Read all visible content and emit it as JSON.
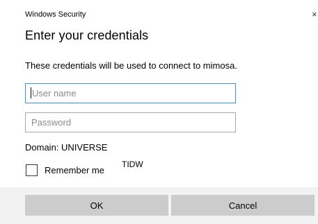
{
  "window": {
    "title": "Windows Security",
    "close_glyph": "×"
  },
  "dialog": {
    "heading": "Enter your credentials",
    "message": "These credentials will be used to connect to mimosa.",
    "username": {
      "value": "",
      "placeholder": "User name"
    },
    "password": {
      "value": "",
      "placeholder": "Password"
    },
    "domain": "Domain: UNIVERSE",
    "remember_me": {
      "label": "Remember me",
      "checked": false
    },
    "overlay_text": "TIDW"
  },
  "buttons": {
    "ok": "OK",
    "cancel": "Cancel"
  },
  "colors": {
    "focus_border": "#3a8fd6",
    "field_border": "#a8a8a8",
    "button_bg": "#cccccc",
    "footer_bg": "#f2f2f2"
  }
}
